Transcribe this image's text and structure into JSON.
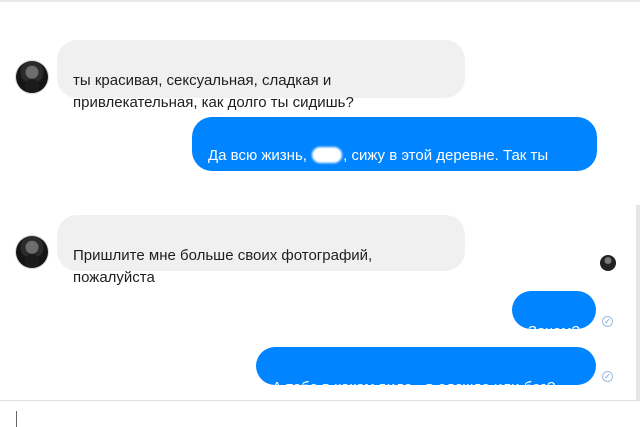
{
  "messages": [
    {
      "direction": "incoming",
      "text": "ты красивая, сексуальная, сладкая и\nпривлекательная, как долго ты сидишь?"
    },
    {
      "direction": "outgoing",
      "text_before": "Да всю жизнь, ",
      "text_after": ", сижу в этой деревне. Так ты\nко мне приедешь или нет?"
    },
    {
      "direction": "incoming",
      "text": "Пришлите мне больше своих фотографий,\nпожалуйста"
    },
    {
      "direction": "outgoing",
      "text": "Зачем?"
    },
    {
      "direction": "outgoing",
      "text": "А тебе в каком виде - в одежде или без?"
    }
  ],
  "icons": {
    "avatar": "contact-avatar",
    "read_receipt": "seen-avatar",
    "delivered": "check-circle-icon"
  },
  "colors": {
    "outgoing_bubble": "#0084ff",
    "incoming_bubble": "#f1f0f0",
    "outgoing_text": "#ffffff",
    "incoming_text": "#1c1e21"
  }
}
